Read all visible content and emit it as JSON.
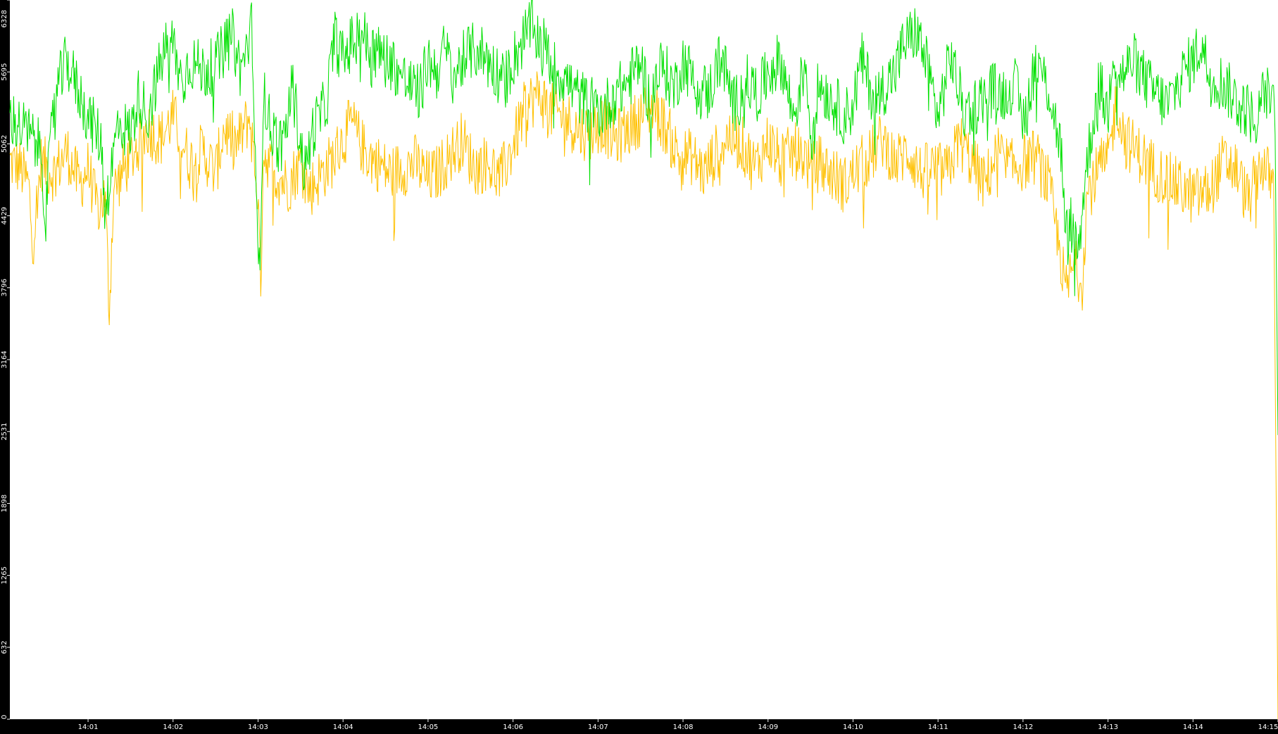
{
  "chart_data": {
    "type": "line",
    "title": "",
    "xlabel": "",
    "ylabel": "",
    "ylim": [
      0,
      6328
    ],
    "y_ticks": [
      "0",
      "632",
      "1265",
      "1898",
      "2531",
      "3164",
      "3796",
      "4429",
      "5062",
      "5695",
      "6328"
    ],
    "x_ticks": [
      "14:01",
      "14:02",
      "14:03",
      "14:04",
      "14:05",
      "14:06",
      "14:07",
      "14:08",
      "14:09",
      "14:10",
      "14:11",
      "14:12",
      "14:13",
      "14:14",
      "14:15"
    ],
    "x_range_minutes": [
      0.08,
      15.0
    ],
    "background": "#ffffff",
    "page_background": "#000000",
    "axis_color": "#000000",
    "series": [
      {
        "color": "#00e000",
        "x_minutes": [
          0.08,
          0.3,
          0.45,
          0.5,
          0.6,
          0.75,
          0.9,
          1.0,
          1.15,
          1.2,
          1.27,
          1.35,
          1.5,
          1.6,
          1.7,
          1.9,
          2.0,
          2.1,
          2.2,
          2.35,
          2.5,
          2.6,
          2.7,
          2.8,
          2.93,
          3.0,
          3.03,
          3.06,
          3.15,
          3.3,
          3.4,
          3.55,
          3.65,
          3.8,
          3.9,
          4.0,
          4.1,
          4.2,
          4.3,
          4.45,
          4.6,
          4.75,
          4.9,
          5.0,
          5.1,
          5.2,
          5.3,
          5.45,
          5.6,
          5.8,
          5.9,
          6.0,
          6.1,
          6.2,
          6.35,
          6.5,
          6.6,
          6.75,
          6.9,
          7.05,
          7.2,
          7.35,
          7.5,
          7.6,
          7.75,
          7.9,
          8.0,
          8.15,
          8.3,
          8.45,
          8.6,
          8.75,
          8.9,
          9.0,
          9.15,
          9.3,
          9.45,
          9.5,
          9.6,
          9.75,
          9.9,
          10.0,
          10.1,
          10.25,
          10.4,
          10.5,
          10.6,
          10.75,
          10.85,
          10.9,
          11.0,
          11.15,
          11.3,
          11.45,
          11.6,
          11.75,
          11.9,
          12.0,
          12.15,
          12.3,
          12.45,
          12.5,
          12.55,
          12.65,
          12.72,
          12.8,
          12.9,
          13.0,
          13.05,
          13.15,
          13.3,
          13.5,
          13.7,
          13.9,
          14.0,
          14.1,
          14.2,
          14.35,
          14.5,
          14.65,
          14.75,
          14.85,
          14.97,
          15.0
        ],
        "values": [
          5300,
          5150,
          5000,
          4420,
          5450,
          5800,
          5500,
          5300,
          5100,
          4500,
          4800,
          5250,
          5150,
          5500,
          5300,
          5900,
          5950,
          5600,
          5800,
          5700,
          5750,
          5900,
          6000,
          5700,
          6100,
          3900,
          4300,
          5500,
          5200,
          5000,
          5600,
          4800,
          5200,
          5400,
          6000,
          5800,
          5950,
          6100,
          5900,
          5850,
          5750,
          5600,
          5500,
          5800,
          5700,
          5900,
          5650,
          5850,
          5900,
          5700,
          5600,
          5800,
          5950,
          6100,
          5950,
          5700,
          5650,
          5500,
          5400,
          5350,
          5500,
          5600,
          5800,
          5450,
          5750,
          5550,
          5800,
          5600,
          5500,
          5850,
          5400,
          5600,
          5500,
          5700,
          5800,
          5300,
          5800,
          5100,
          5600,
          5450,
          5300,
          5400,
          5800,
          5450,
          5600,
          5700,
          5950,
          6050,
          5800,
          5650,
          5300,
          5850,
          5350,
          5400,
          5550,
          5500,
          5600,
          5250,
          5800,
          5550,
          5000,
          4200,
          4400,
          4100,
          4700,
          5150,
          5600,
          5300,
          5900,
          5650,
          5800,
          5550,
          5400,
          5700,
          5800,
          5950,
          5650,
          5600,
          5450,
          5350,
          5250,
          5550,
          5300,
          2500
        ]
      },
      {
        "color": "#ffc000",
        "x_minutes": [
          0.08,
          0.2,
          0.3,
          0.35,
          0.45,
          0.6,
          0.75,
          0.9,
          1.0,
          1.1,
          1.2,
          1.25,
          1.3,
          1.4,
          1.55,
          1.7,
          1.85,
          2.0,
          2.1,
          2.2,
          2.35,
          2.5,
          2.6,
          2.75,
          2.9,
          3.0,
          3.03,
          3.06,
          3.2,
          3.35,
          3.5,
          3.6,
          3.75,
          3.9,
          4.0,
          4.1,
          4.25,
          4.4,
          4.55,
          4.7,
          4.85,
          5.0,
          5.1,
          5.25,
          5.4,
          5.55,
          5.7,
          5.85,
          6.0,
          6.15,
          6.3,
          6.45,
          6.6,
          6.75,
          6.9,
          7.05,
          7.2,
          7.35,
          7.5,
          7.65,
          7.8,
          7.95,
          8.1,
          8.25,
          8.4,
          8.55,
          8.7,
          8.85,
          9.0,
          9.15,
          9.3,
          9.45,
          9.5,
          9.6,
          9.75,
          9.9,
          10.05,
          10.2,
          10.35,
          10.5,
          10.65,
          10.8,
          10.95,
          11.1,
          11.25,
          11.4,
          11.55,
          11.7,
          11.85,
          12.0,
          12.15,
          12.3,
          12.45,
          12.5,
          12.6,
          12.7,
          12.75,
          12.9,
          13.0,
          13.1,
          13.2,
          13.4,
          13.6,
          13.8,
          14.0,
          14.2,
          14.35,
          14.5,
          14.65,
          14.8,
          14.95,
          15.0
        ],
        "values": [
          4900,
          4850,
          4700,
          4200,
          4900,
          4800,
          5000,
          4700,
          4850,
          4500,
          4600,
          3600,
          4650,
          4800,
          5000,
          5200,
          5100,
          5300,
          5100,
          4900,
          5000,
          4800,
          5200,
          5050,
          5300,
          4600,
          3700,
          5000,
          4800,
          4700,
          4900,
          4650,
          4800,
          4950,
          5100,
          5250,
          5000,
          4900,
          4800,
          4850,
          4900,
          4750,
          4800,
          4950,
          5100,
          4850,
          4900,
          4750,
          5050,
          5400,
          5500,
          5350,
          5300,
          5200,
          5150,
          5250,
          5100,
          5200,
          5300,
          5400,
          5200,
          4950,
          4950,
          4800,
          5000,
          5150,
          5050,
          4850,
          5100,
          4900,
          5000,
          4950,
          4800,
          4900,
          4800,
          4700,
          4850,
          4950,
          5100,
          4900,
          5000,
          4800,
          4850,
          4800,
          5100,
          4900,
          4700,
          5000,
          4850,
          4900,
          4950,
          4700,
          4050,
          3750,
          4000,
          3850,
          4600,
          4850,
          4900,
          5450,
          5100,
          4950,
          4800,
          4700,
          4600,
          4650,
          4900,
          4850,
          4550,
          4900,
          4700,
          0
        ]
      }
    ]
  }
}
